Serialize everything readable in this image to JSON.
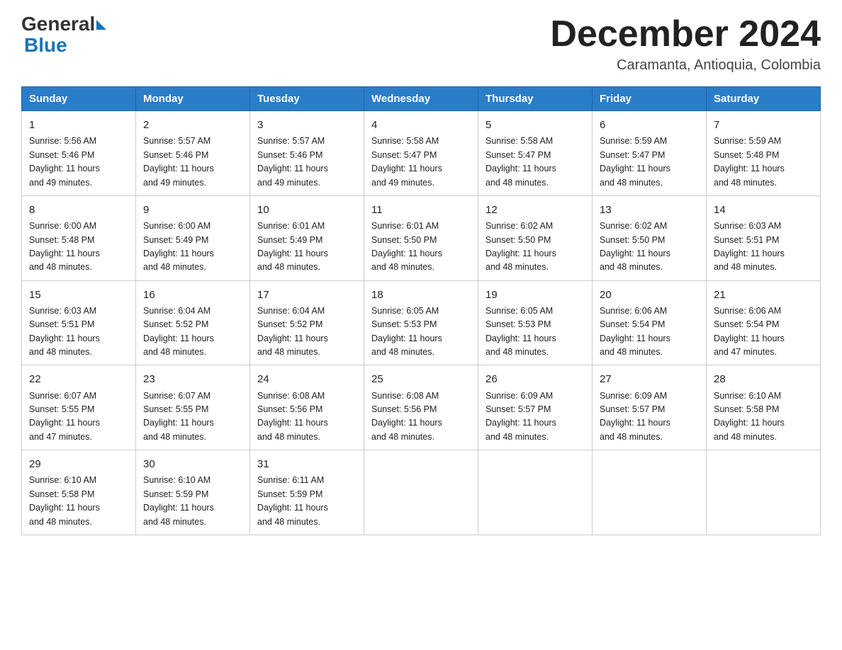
{
  "header": {
    "logo_general": "General",
    "logo_blue": "Blue",
    "month_title": "December 2024",
    "location": "Caramanta, Antioquia, Colombia"
  },
  "days_of_week": [
    "Sunday",
    "Monday",
    "Tuesday",
    "Wednesday",
    "Thursday",
    "Friday",
    "Saturday"
  ],
  "weeks": [
    [
      {
        "day": "1",
        "info": "Sunrise: 5:56 AM\nSunset: 5:46 PM\nDaylight: 11 hours\nand 49 minutes."
      },
      {
        "day": "2",
        "info": "Sunrise: 5:57 AM\nSunset: 5:46 PM\nDaylight: 11 hours\nand 49 minutes."
      },
      {
        "day": "3",
        "info": "Sunrise: 5:57 AM\nSunset: 5:46 PM\nDaylight: 11 hours\nand 49 minutes."
      },
      {
        "day": "4",
        "info": "Sunrise: 5:58 AM\nSunset: 5:47 PM\nDaylight: 11 hours\nand 49 minutes."
      },
      {
        "day": "5",
        "info": "Sunrise: 5:58 AM\nSunset: 5:47 PM\nDaylight: 11 hours\nand 48 minutes."
      },
      {
        "day": "6",
        "info": "Sunrise: 5:59 AM\nSunset: 5:47 PM\nDaylight: 11 hours\nand 48 minutes."
      },
      {
        "day": "7",
        "info": "Sunrise: 5:59 AM\nSunset: 5:48 PM\nDaylight: 11 hours\nand 48 minutes."
      }
    ],
    [
      {
        "day": "8",
        "info": "Sunrise: 6:00 AM\nSunset: 5:48 PM\nDaylight: 11 hours\nand 48 minutes."
      },
      {
        "day": "9",
        "info": "Sunrise: 6:00 AM\nSunset: 5:49 PM\nDaylight: 11 hours\nand 48 minutes."
      },
      {
        "day": "10",
        "info": "Sunrise: 6:01 AM\nSunset: 5:49 PM\nDaylight: 11 hours\nand 48 minutes."
      },
      {
        "day": "11",
        "info": "Sunrise: 6:01 AM\nSunset: 5:50 PM\nDaylight: 11 hours\nand 48 minutes."
      },
      {
        "day": "12",
        "info": "Sunrise: 6:02 AM\nSunset: 5:50 PM\nDaylight: 11 hours\nand 48 minutes."
      },
      {
        "day": "13",
        "info": "Sunrise: 6:02 AM\nSunset: 5:50 PM\nDaylight: 11 hours\nand 48 minutes."
      },
      {
        "day": "14",
        "info": "Sunrise: 6:03 AM\nSunset: 5:51 PM\nDaylight: 11 hours\nand 48 minutes."
      }
    ],
    [
      {
        "day": "15",
        "info": "Sunrise: 6:03 AM\nSunset: 5:51 PM\nDaylight: 11 hours\nand 48 minutes."
      },
      {
        "day": "16",
        "info": "Sunrise: 6:04 AM\nSunset: 5:52 PM\nDaylight: 11 hours\nand 48 minutes."
      },
      {
        "day": "17",
        "info": "Sunrise: 6:04 AM\nSunset: 5:52 PM\nDaylight: 11 hours\nand 48 minutes."
      },
      {
        "day": "18",
        "info": "Sunrise: 6:05 AM\nSunset: 5:53 PM\nDaylight: 11 hours\nand 48 minutes."
      },
      {
        "day": "19",
        "info": "Sunrise: 6:05 AM\nSunset: 5:53 PM\nDaylight: 11 hours\nand 48 minutes."
      },
      {
        "day": "20",
        "info": "Sunrise: 6:06 AM\nSunset: 5:54 PM\nDaylight: 11 hours\nand 48 minutes."
      },
      {
        "day": "21",
        "info": "Sunrise: 6:06 AM\nSunset: 5:54 PM\nDaylight: 11 hours\nand 47 minutes."
      }
    ],
    [
      {
        "day": "22",
        "info": "Sunrise: 6:07 AM\nSunset: 5:55 PM\nDaylight: 11 hours\nand 47 minutes."
      },
      {
        "day": "23",
        "info": "Sunrise: 6:07 AM\nSunset: 5:55 PM\nDaylight: 11 hours\nand 48 minutes."
      },
      {
        "day": "24",
        "info": "Sunrise: 6:08 AM\nSunset: 5:56 PM\nDaylight: 11 hours\nand 48 minutes."
      },
      {
        "day": "25",
        "info": "Sunrise: 6:08 AM\nSunset: 5:56 PM\nDaylight: 11 hours\nand 48 minutes."
      },
      {
        "day": "26",
        "info": "Sunrise: 6:09 AM\nSunset: 5:57 PM\nDaylight: 11 hours\nand 48 minutes."
      },
      {
        "day": "27",
        "info": "Sunrise: 6:09 AM\nSunset: 5:57 PM\nDaylight: 11 hours\nand 48 minutes."
      },
      {
        "day": "28",
        "info": "Sunrise: 6:10 AM\nSunset: 5:58 PM\nDaylight: 11 hours\nand 48 minutes."
      }
    ],
    [
      {
        "day": "29",
        "info": "Sunrise: 6:10 AM\nSunset: 5:58 PM\nDaylight: 11 hours\nand 48 minutes."
      },
      {
        "day": "30",
        "info": "Sunrise: 6:10 AM\nSunset: 5:59 PM\nDaylight: 11 hours\nand 48 minutes."
      },
      {
        "day": "31",
        "info": "Sunrise: 6:11 AM\nSunset: 5:59 PM\nDaylight: 11 hours\nand 48 minutes."
      },
      null,
      null,
      null,
      null
    ]
  ]
}
